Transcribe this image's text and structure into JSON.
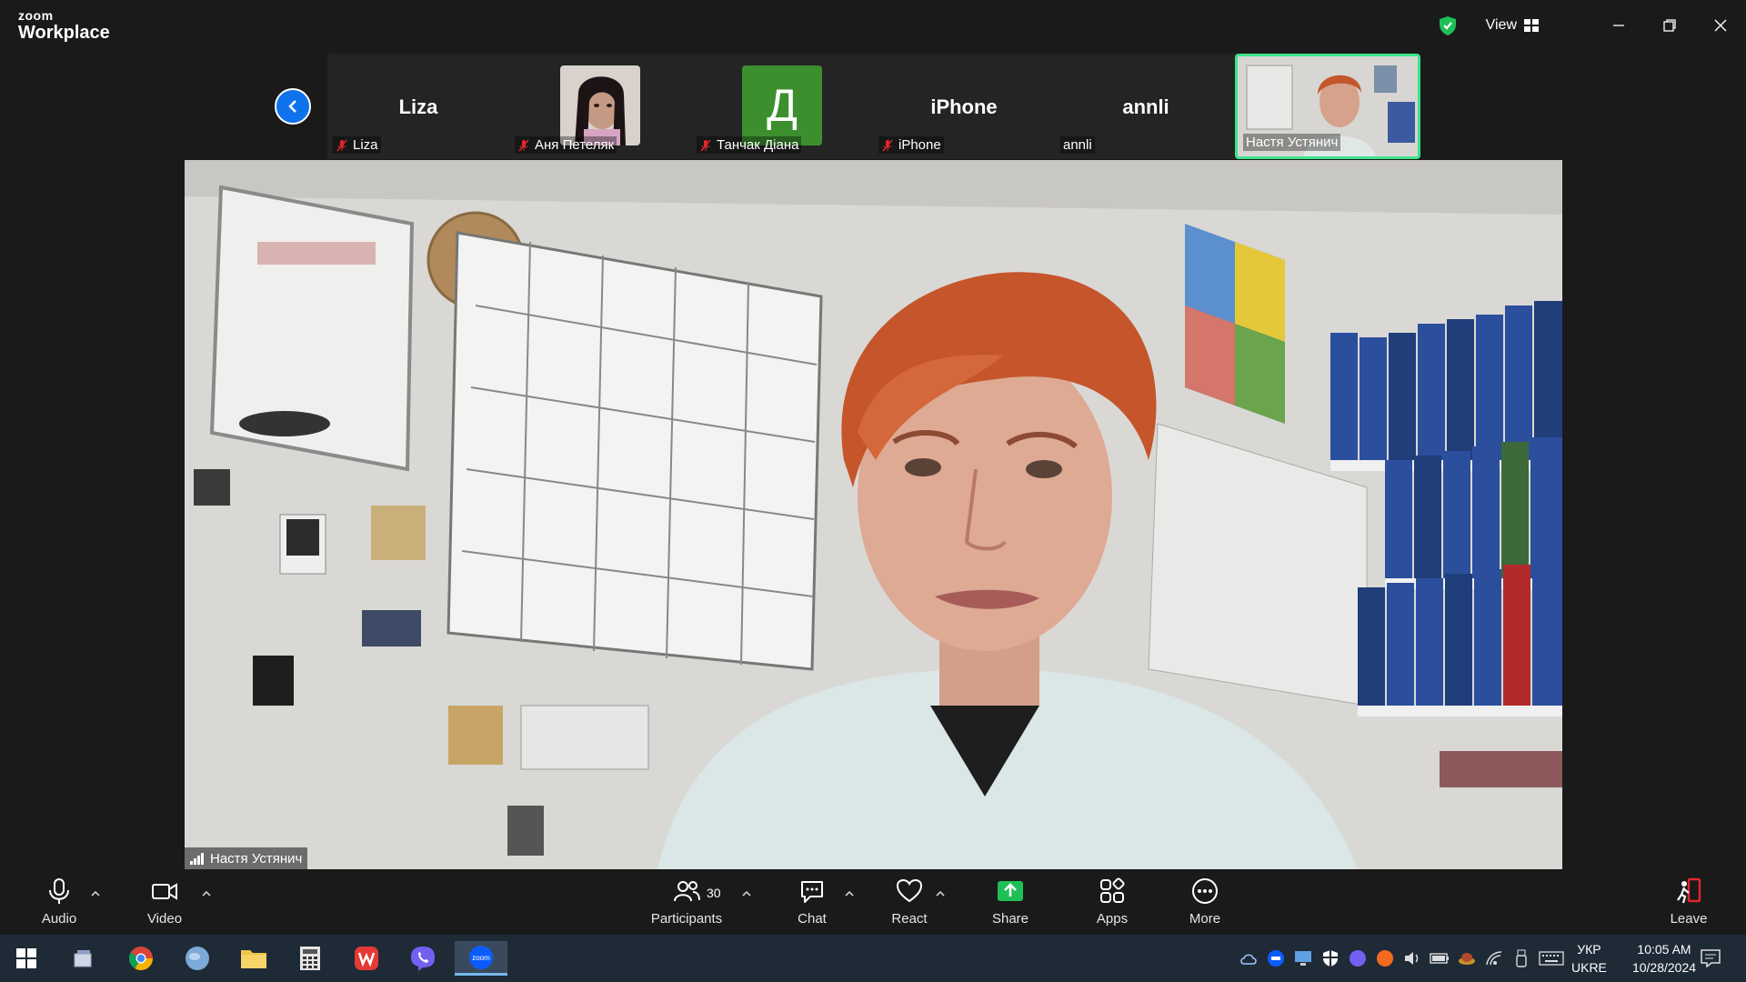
{
  "app": {
    "brand_small": "zoom",
    "brand_big": "Workplace",
    "view_label": "View"
  },
  "colors": {
    "accent": "#0e72ed",
    "active_border": "#3ee38c",
    "share_green": "#1fbf57",
    "leave_red": "#e0262f"
  },
  "participants_strip": [
    {
      "name": "Liza",
      "label": "Liza",
      "muted": true,
      "kind": "name"
    },
    {
      "name": "",
      "label": "Аня Петеляк",
      "muted": true,
      "kind": "photo"
    },
    {
      "name": "Д",
      "label": "Танчак Діана",
      "muted": true,
      "kind": "avatar"
    },
    {
      "name": "iPhone",
      "label": "iPhone",
      "muted": true,
      "kind": "name"
    },
    {
      "name": "annli",
      "label": "annli",
      "muted": false,
      "kind": "name"
    },
    {
      "name": "",
      "label": "Настя Устянич",
      "muted": false,
      "kind": "self"
    }
  ],
  "main_video": {
    "speaker_label": "Настя Устянич"
  },
  "toolbar": {
    "audio": "Audio",
    "video": "Video",
    "participants": "Participants",
    "participants_count": "30",
    "chat": "Chat",
    "react": "React",
    "share": "Share",
    "apps": "Apps",
    "more": "More",
    "leave": "Leave"
  },
  "taskbar": {
    "lang_top": "УКР",
    "lang_bottom": "UKRE",
    "time": "10:05 AM",
    "date": "10/28/2024"
  }
}
